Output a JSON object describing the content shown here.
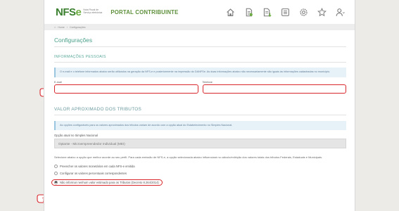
{
  "header": {
    "logo_main": "NFS",
    "logo_e": "e",
    "logo_sub": "Nota Fiscal de Serviço eletrônica",
    "portal_title": "PORTAL CONTRIBUINTE",
    "icons": [
      "home-icon",
      "document-icon",
      "document-download-icon",
      "list-icon",
      "gear-icon",
      "star-icon",
      "user-icon"
    ]
  },
  "breadcrumb": {
    "home": "Home",
    "separator": "›",
    "current": "Configurações"
  },
  "page": {
    "title": "Configurações"
  },
  "personal": {
    "title": "INFORMAÇÕES PESSOAIS",
    "info": "O e-mail e o telefone informados abaixo serão utilizados na geração da NFS-e e posteriormente na impressão do DANFSe. As duas informações abaixo não necessariamente são iguais às informações cadastradas no município.",
    "email_label": "E-mail",
    "email_value": "",
    "phone_label": "Telefone",
    "phone_value": ""
  },
  "tributos": {
    "title": "VALOR APROXIMADO DOS TRIBUTOS",
    "info": "As opções configuráveis para os valores aproximados dos tributos variam de acordo com a opção atual do Estabelecimento no Simples Nacional.",
    "option_label": "Opção atual no Simples Nacional",
    "option_value": "Optante - Microempreendedor Individual (MEI)",
    "description": "Selecione abaixo a opção que melhor acorde ao seu perfil. Para cada emissão de NFS-e, a opção selecionada abaixo influenciará no cálculo/exibição dos valores totais dos tributos Federais, Estaduais e Municipais.",
    "radios": [
      {
        "label": "Preencher os valores monetários em cada NFS-e emitida",
        "checked": false
      },
      {
        "label": "Configurar os valores percentuais correspondentes",
        "checked": false
      },
      {
        "label": "Não informar nenhum valor estimado para os Tributos (Decreto 8.264/2014)",
        "checked": true
      }
    ]
  },
  "colors": {
    "brand_green": "#6fae45",
    "highlight_red": "#d8262c",
    "accent_teal": "#4a9f8a"
  }
}
